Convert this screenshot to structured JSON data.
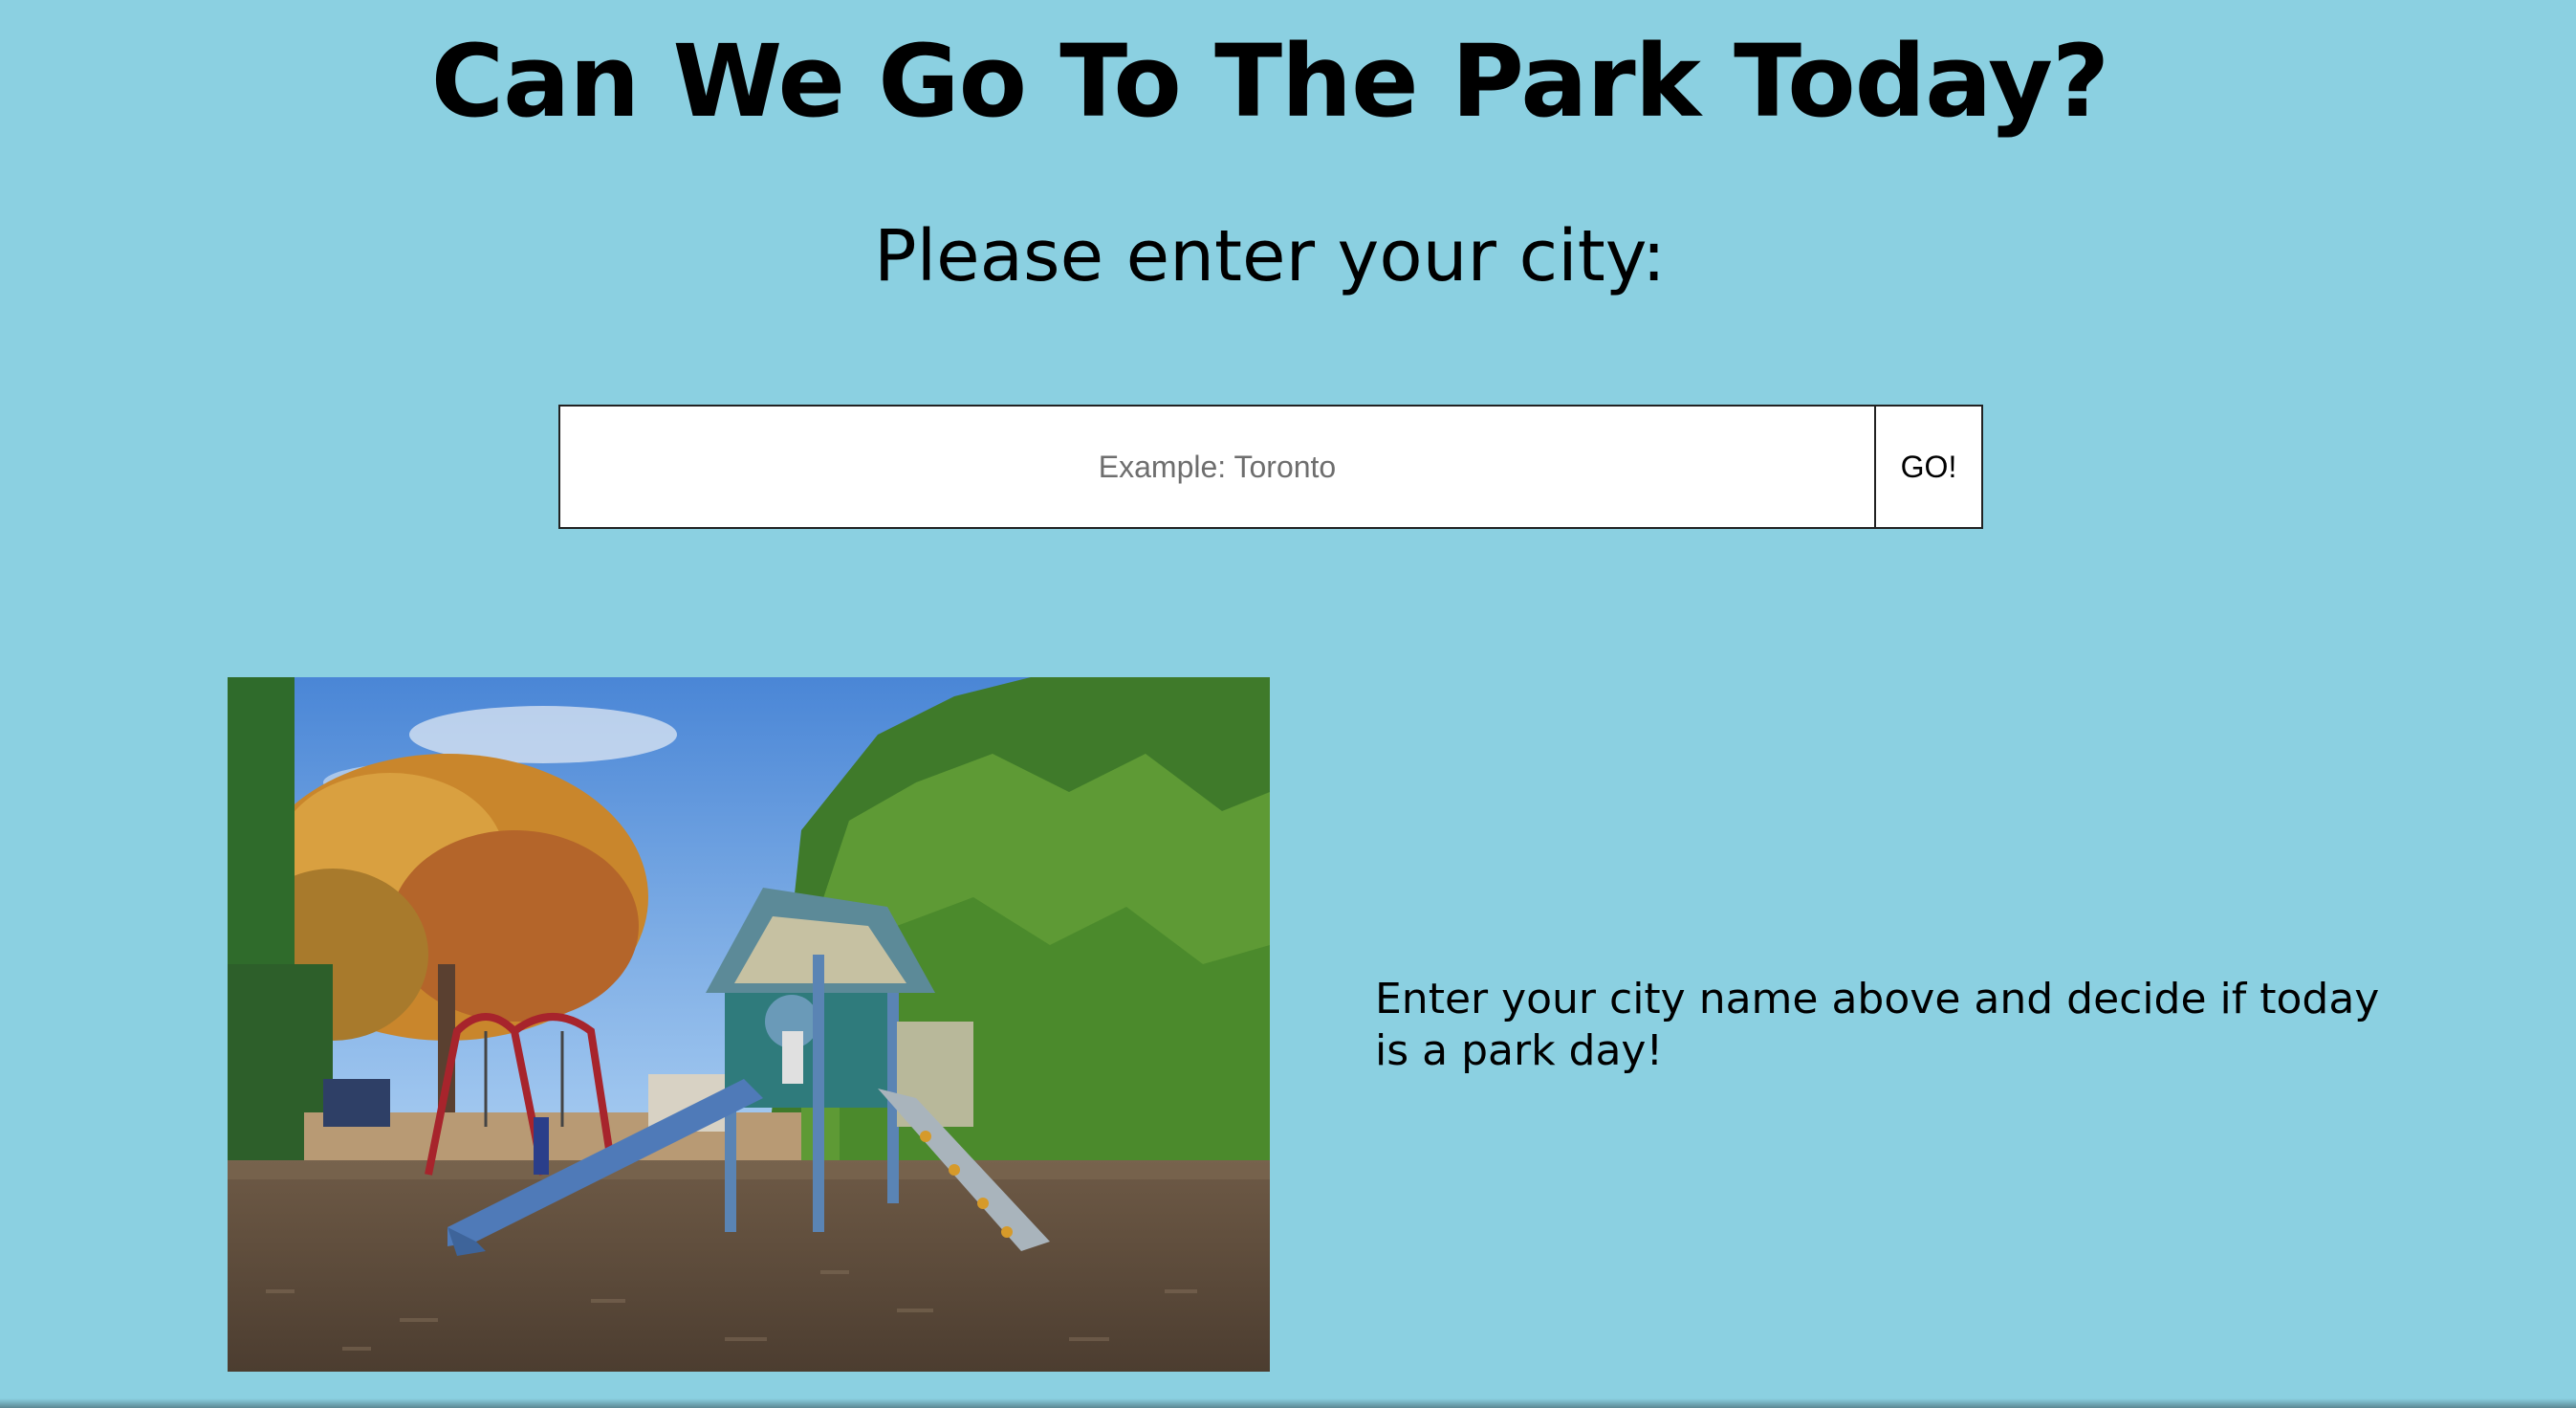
{
  "header": {
    "title": "Can We Go To The Park Today?",
    "prompt": "Please enter your city:"
  },
  "search": {
    "placeholder": "Example: Toronto",
    "value": "",
    "button_label": "GO!"
  },
  "content": {
    "image_alt": "Playground with a blue slide, swings and autumn trees",
    "message": "Enter your city name above and decide if today is a park day!"
  },
  "colors": {
    "background": "#8bd0e1",
    "text": "#000000",
    "input_background": "#ffffff"
  }
}
